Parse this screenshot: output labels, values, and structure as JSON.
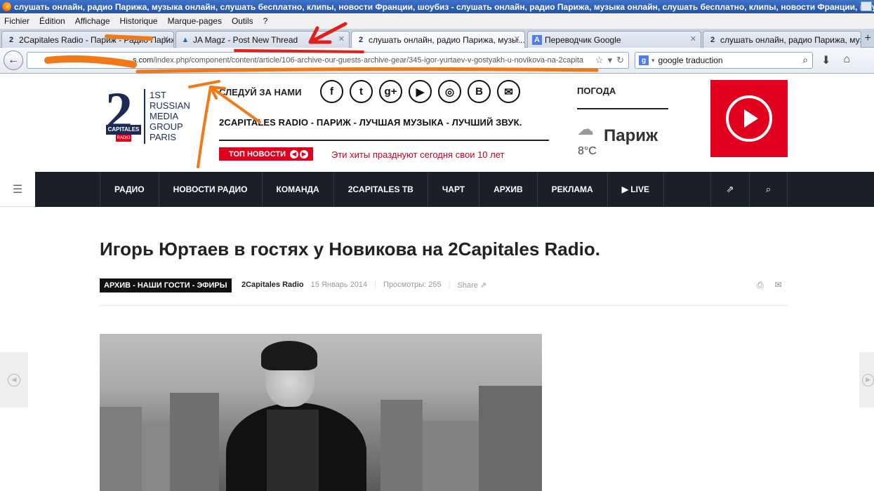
{
  "browser": {
    "window_title": "слушать онлайн, радио Парижа, музыка онлайн, слушать бесплатно, клипы, новости Франции, шоубиз - слушать онлайн, радио Парижа, музыка онлайн, слушать бесплатно, клипы, новости Франции, шоуб...",
    "menu": [
      "Fichier",
      "Édition",
      "Affichage",
      "Historique",
      "Marque-pages",
      "Outils",
      "?"
    ],
    "tabs": [
      {
        "label": "2Capitales Radio - Париж - Радио Париж..."
      },
      {
        "label": "JA Magz - Post New Thread"
      },
      {
        "label": "слушать онлайн, радио Парижа, музы..."
      },
      {
        "label": "Переводчик Google"
      },
      {
        "label": "слушать онлайн, радио Парижа, музы..."
      }
    ],
    "url_domain": "s.com",
    "url_path": "/index.php/component/content/article/106-archive-our-guests-archive-gear/345-igor-yurtaev-v-gostyakh-u-novikova-na-2capita",
    "search_value": "google traduction",
    "search_engine_icon": "g"
  },
  "site": {
    "logo_number": "2",
    "logo_band": "CAPITALES",
    "logo_radio": "RADIO",
    "logo_lines": [
      "1ST",
      "RUSSIAN",
      "MEDIA",
      "GROUP",
      "PARIS"
    ],
    "follow_label": "СЛЕДУЙ ЗА НАМИ",
    "social": [
      "f",
      "t",
      "g+",
      "▶",
      "◎",
      "B",
      "✉"
    ],
    "slogan": "2CAPITALES RADIO - ПАРИЖ - ЛУЧШАЯ МУЗЫКА - ЛУЧШИЙ ЗВУК.",
    "top_news_label": "ТОП НОВОСТИ",
    "ticker": "Эти хиты празднуют сегодня свои 10 лет",
    "weather_label": "ПОГОДА",
    "weather_city": "Париж",
    "weather_temp": "8°C"
  },
  "nav": {
    "items": [
      "РАДИО",
      "НОВОСТИ РАДИО",
      "КОМАНДА",
      "2CAPITALES ТВ",
      "ЧАРТ",
      "АРХИВ",
      "РЕКЛАМА",
      "▶ LIVE"
    ]
  },
  "article": {
    "title": "Игорь Юртаев в гостях у Новикова на 2Capitales Radio.",
    "category": "АРХИВ - НАШИ ГОСТИ - ЭФИРЫ",
    "author": "2Capitales Radio",
    "date": "15 Январь 2014",
    "views": "Просмотры: 255",
    "share": "Share"
  },
  "colors": {
    "accent_red": "#e1001e",
    "nav_dark": "#1b1f27",
    "logo_navy": "#1d2a55",
    "scribble_orange": "#f07a1a"
  }
}
